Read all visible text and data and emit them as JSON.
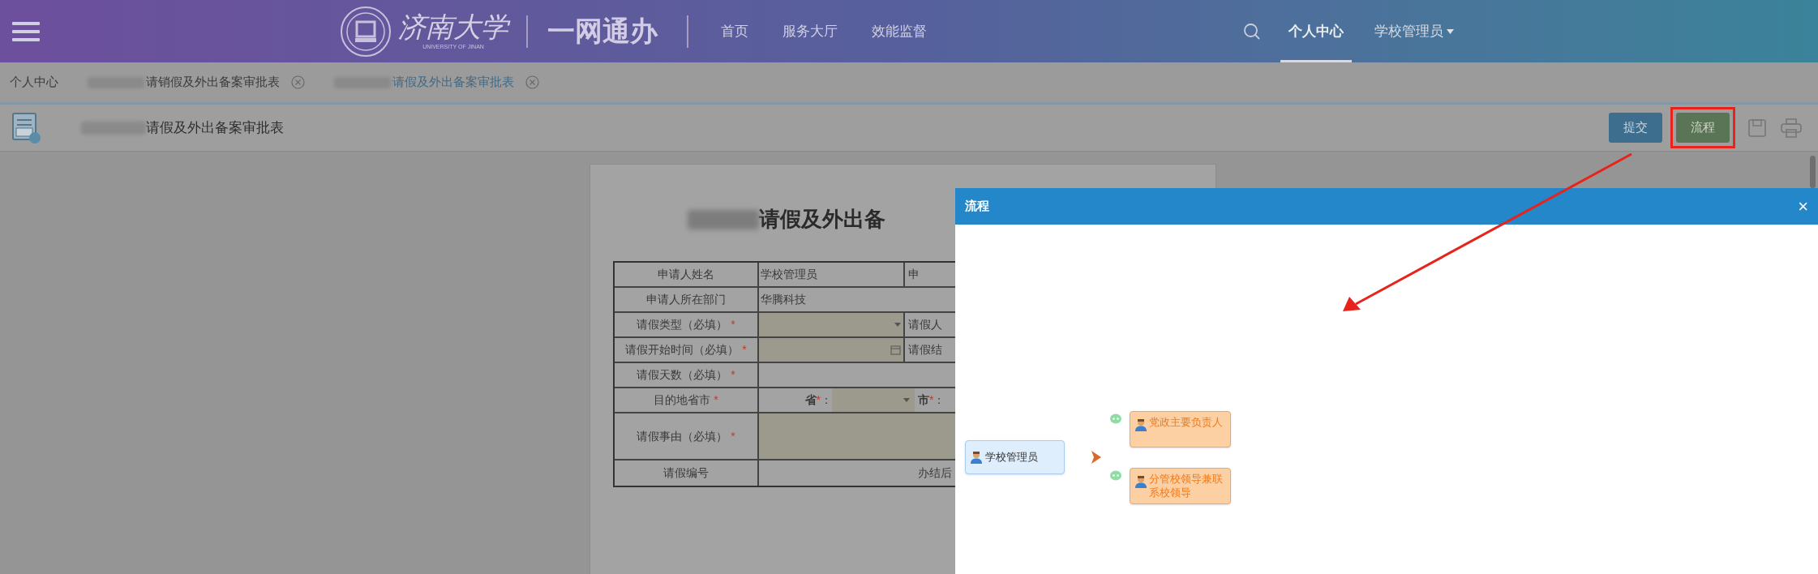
{
  "header": {
    "logo_text": "济南大学",
    "logo_subtitle": "UNIVERSITY OF JINAN",
    "portal_title": "一网通办",
    "nav": [
      {
        "label": "首页"
      },
      {
        "label": "服务大厅"
      },
      {
        "label": "效能监督"
      }
    ],
    "user_menu": [
      {
        "label": "个人中心",
        "selected": true,
        "dropdown": false
      },
      {
        "label": "学校管理员",
        "selected": false,
        "dropdown": true
      }
    ]
  },
  "tabs": [
    {
      "label": "个人中心",
      "selected": false,
      "closable": false,
      "redacted": false
    },
    {
      "label": "请销假及外出备案审批表",
      "selected": false,
      "closable": true,
      "redacted": true
    },
    {
      "label": "请假及外出备案审批表",
      "selected": true,
      "closable": true,
      "redacted": true
    }
  ],
  "toolbar": {
    "title": "请假及外出备案审批表",
    "buttons": [
      {
        "label": "提交",
        "kind": "submit",
        "highlighted": false
      },
      {
        "label": "流程",
        "kind": "flow",
        "highlighted": true
      }
    ]
  },
  "form": {
    "title": "请假及外出备",
    "rows": [
      {
        "label": "申请人姓名",
        "mark": "",
        "cells": [
          {
            "kind": "value",
            "text": "学校管理员"
          },
          {
            "kind": "cut_label",
            "text": "申"
          }
        ]
      },
      {
        "label": "申请人所在部门",
        "mark": "",
        "cells": [
          {
            "kind": "value_wide",
            "text": "华腾科技"
          }
        ]
      },
      {
        "label": "请假类型（必填）",
        "mark": "*",
        "cells": [
          {
            "kind": "select"
          },
          {
            "kind": "cut_label",
            "text": "请假人"
          }
        ]
      },
      {
        "label": "请假开始时间（必填）",
        "mark": "*",
        "cells": [
          {
            "kind": "date"
          },
          {
            "kind": "cut_label",
            "text": "请假结"
          }
        ]
      },
      {
        "label": "请假天数（必填）",
        "mark": "*",
        "cells": [
          {
            "kind": "empty"
          }
        ]
      },
      {
        "label": "目的地省市",
        "mark": "*",
        "cells": [
          {
            "kind": "inline_label",
            "text": "省",
            "mark": "*",
            "colon": "："
          },
          {
            "kind": "select_small"
          },
          {
            "kind": "inline_label",
            "text": "市",
            "mark": "*",
            "colon": "："
          }
        ]
      },
      {
        "label": "请假事由（必填）",
        "mark": "*",
        "cells": [
          {
            "kind": "textarea"
          }
        ]
      },
      {
        "label": "请假编号",
        "mark": "",
        "cells": [
          {
            "kind": "blank"
          },
          {
            "kind": "note",
            "text": "办结后"
          }
        ]
      }
    ]
  },
  "dialog": {
    "title": "流程",
    "close": "×",
    "flow": {
      "start": {
        "label": "学校管理员"
      },
      "next": [
        {
          "label": "党政主要负责人"
        },
        {
          "label": "分管校领导兼联系校领导"
        }
      ]
    }
  }
}
